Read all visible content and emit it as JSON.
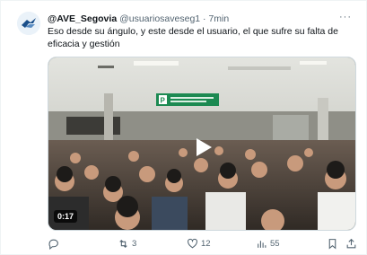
{
  "tweet": {
    "display_name": "@AVE_Segovia",
    "handle": "@usuariosaveseg1",
    "separator": "·",
    "time": "7min",
    "text": "Eso desde su ángulo, y este desde el usuario, el que sufre su falta de eficacia y gestión"
  },
  "media": {
    "duration": "0:17",
    "sign_text": "P",
    "colors": {
      "sign_green": "#1c8a52",
      "ceiling": "#d7d9d4"
    }
  },
  "actions": {
    "reply_count": "",
    "retweet_count": "3",
    "like_count": "12",
    "views_count": "55",
    "icons": [
      "reply-icon",
      "retweet-icon",
      "like-icon",
      "views-icon",
      "bookmark-icon",
      "share-icon"
    ]
  },
  "colors": {
    "secondary_text": "#536471",
    "accent": "#1d9bf0"
  }
}
